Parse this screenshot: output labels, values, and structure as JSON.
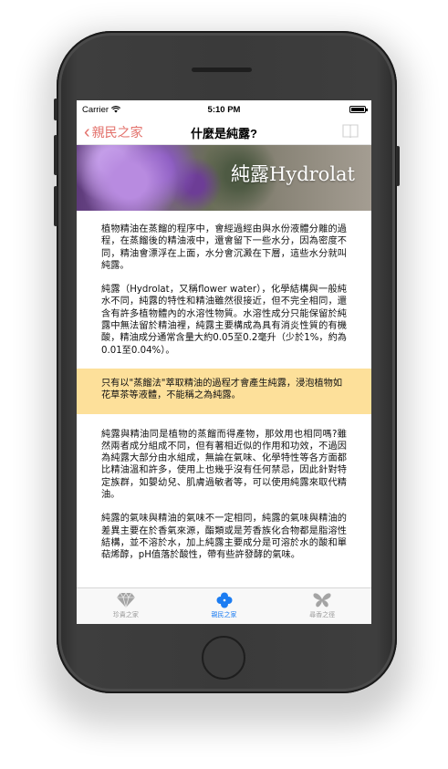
{
  "status_bar": {
    "carrier": "Carrier",
    "time": "5:10 PM"
  },
  "nav": {
    "back_label": "親民之家",
    "title": "什麼是純露?",
    "right_icon": "book-icon"
  },
  "banner": {
    "title": "純露Hydrolat"
  },
  "content": {
    "paragraphs_top": [
      "植物精油在蒸餾的程序中，會經過經由與水份液體分離的過程，在蒸餾後的精油液中，還會留下一些水分，因為密度不同，精油會漂浮在上面，水分會沉澱在下層，這些水分就叫純露。",
      "純露（Hydrolat，又稱flower water），化學結構與一般純水不同，純露的特性和精油雖然很接近，但不完全相同，還含有許多植物體內的水溶性物質。水溶性成分只能保留於純露中無法留於精油裡，純露主要構成為具有消炎性質的有機酸，精油成分通常含量大約0.05至0.2毫升（少於1%，約為0.01至0.04%）。"
    ],
    "highlight": "只有以\"蒸餾法\"萃取精油的過程才會產生純露，浸泡植物如花草茶等液體，不能稱之為純露。",
    "paragraphs_bottom": [
      "純露與精油同是植物的蒸餾而得產物，那效用也相同嗎?雖然兩者成分組成不同，但有著相近似的作用和功效，不過因為純露大部分由水組成，無論在氣味、化學特性等各方面都比精油溫和許多，使用上也幾乎沒有任何禁忌，因此針對特定族群，如嬰幼兒、肌膚過敏者等，可以使用純露來取代精油。",
      "純露的氣味與精油的氣味不一定相同，純露的氣味與精油的差異主要在於香氣來源，酯類或是芳香族化合物都是脂溶性結構，並不溶於水，加上純露主要成分是可溶於水的酸和單萜烯醇，pH值落於酸性，帶有些許發酵的氣味。"
    ]
  },
  "tabs": [
    {
      "label": "珍貴之家",
      "icon": "diamond-icon",
      "active": false
    },
    {
      "label": "親民之家",
      "icon": "clover-icon",
      "active": true
    },
    {
      "label": "尋香之徑",
      "icon": "butterfly-icon",
      "active": false
    }
  ],
  "colors": {
    "accent": "#e3716b",
    "tab_active": "#1b7cf2",
    "highlight_bg": "#fde09a"
  }
}
